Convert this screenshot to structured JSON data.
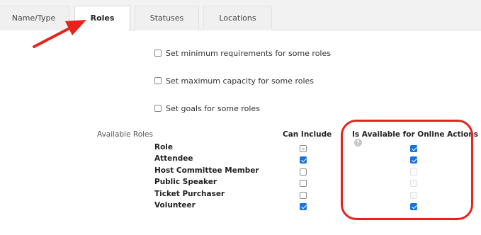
{
  "tabs": [
    {
      "label": "Name/Type",
      "active": false
    },
    {
      "label": "Roles",
      "active": true
    },
    {
      "label": "Statuses",
      "active": false
    },
    {
      "label": "Locations",
      "active": false
    }
  ],
  "options": [
    {
      "label": "Set minimum requirements for some roles",
      "checked": false
    },
    {
      "label": "Set maximum capacity for some roles",
      "checked": false
    },
    {
      "label": "Set goals for some roles",
      "checked": false
    }
  ],
  "roles_table": {
    "section_label": "Available Roles",
    "col_can_include": "Can Include",
    "col_online": "Is Available for Online Actions",
    "help_glyph": "?",
    "rows": [
      {
        "name": "Role",
        "can_include": "indeterminate",
        "online": "checked"
      },
      {
        "name": "Attendee",
        "can_include": "checked",
        "online": "checked"
      },
      {
        "name": "Host Committee Member",
        "can_include": "unchecked",
        "online": "disabled"
      },
      {
        "name": "Public Speaker",
        "can_include": "unchecked",
        "online": "disabled"
      },
      {
        "name": "Ticket Purchaser",
        "can_include": "unchecked",
        "online": "disabled"
      },
      {
        "name": "Volunteer",
        "can_include": "checked",
        "online": "checked"
      }
    ]
  },
  "annotations": {
    "arrow_color": "#e8231c",
    "highlight_color": "#e8231c"
  },
  "colors": {
    "checkbox_checked": "#1a73d9",
    "tab_bar_bg": "#f2f2f2"
  }
}
